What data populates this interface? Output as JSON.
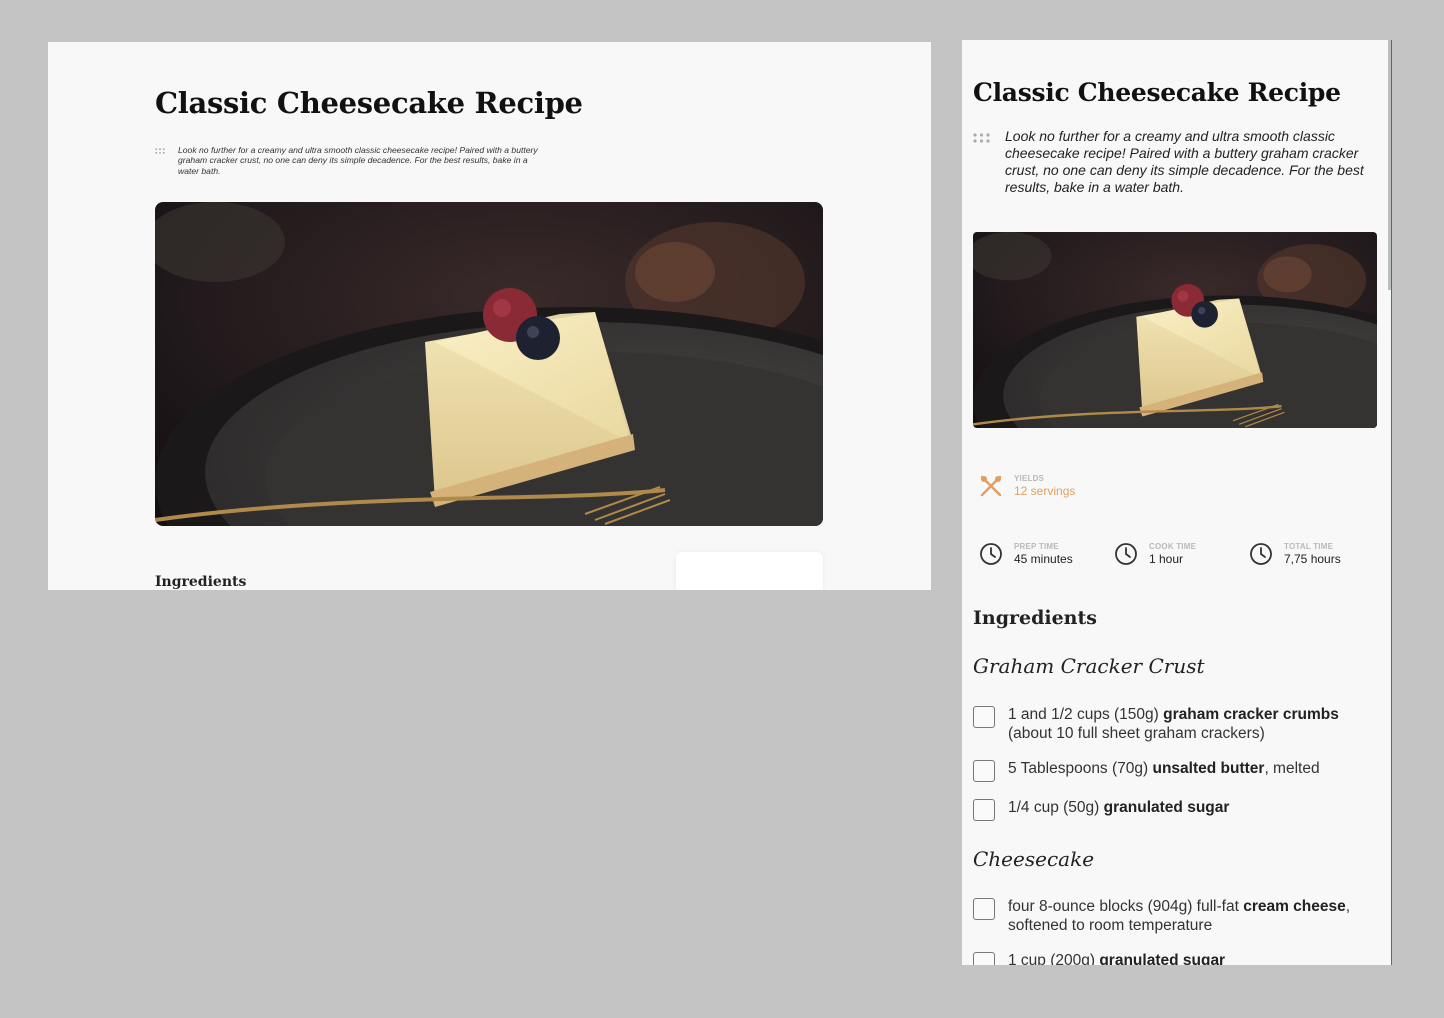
{
  "recipe": {
    "title": "Classic Cheesecake Recipe",
    "description": "Look no further for a creamy and ultra smooth classic cheesecake recipe! Paired with a buttery graham cracker crust, no one can deny its simple decadence. For the best results, bake in a water bath.",
    "ingredients_heading": "Ingredients"
  },
  "meta": {
    "yields": {
      "label": "YIELDS",
      "value": "12 servings",
      "icon": "fork-knife-icon"
    },
    "prep": {
      "label": "PREP TIME",
      "value": "45 minutes",
      "icon": "clock-icon"
    },
    "cook": {
      "label": "COOK TIME",
      "value": "1 hour",
      "icon": "clock-icon"
    },
    "total": {
      "label": "TOTAL TIME",
      "value": "7,75 hours",
      "icon": "clock-icon"
    }
  },
  "groups": [
    {
      "name": "Graham Cracker Crust",
      "items": [
        {
          "pre": "1 and 1/2 cups (150g) ",
          "bold": "graham cracker crumbs",
          "post": " (about 10 full sheet graham crackers)"
        },
        {
          "pre": "5 Tablespoons (70g) ",
          "bold": "unsalted butter",
          "post": ", melted"
        },
        {
          "pre": "1/4 cup (50g) ",
          "bold": "granulated sugar",
          "post": ""
        }
      ]
    },
    {
      "name": "Cheesecake",
      "items": [
        {
          "pre": "four 8-ounce blocks (904g) full-fat ",
          "bold": "cream cheese",
          "post": ", softened to room temperature"
        },
        {
          "pre": "1 cup (200g) ",
          "bold": "granulated sugar",
          "post": ""
        }
      ]
    }
  ],
  "colors": {
    "accent": "#e0a060",
    "page": "#f8f8f8",
    "backdrop": "#c4c4c4"
  }
}
